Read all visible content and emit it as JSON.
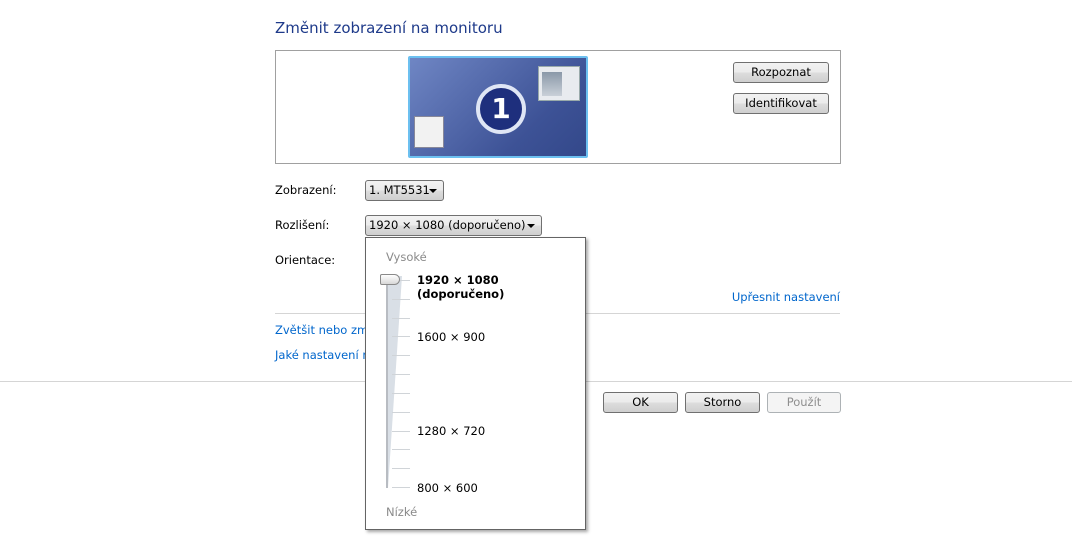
{
  "title": "Změnit zobrazení na monitoru",
  "preview": {
    "monitor_number": "1",
    "detect_button": "Rozpoznat",
    "identify_button": "Identifikovat"
  },
  "display": {
    "label": "Zobrazení:",
    "value": "1. MT5531"
  },
  "resolution": {
    "label": "Rozlišení:",
    "value": "1920 × 1080 (doporučeno)"
  },
  "orientation": {
    "label": "Orientace:"
  },
  "advanced_link": "Upřesnit nastavení",
  "links": [
    "Zvětšit nebo zme",
    "Jaké nastavení m"
  ],
  "buttons": {
    "ok": "OK",
    "cancel": "Storno",
    "apply": "Použít"
  },
  "dropdown": {
    "high_label": "Vysoké",
    "low_label": "Nízké",
    "options": [
      "1920 × 1080 (doporučeno)",
      "1600 × 900",
      "1280 × 720",
      "800 × 600"
    ],
    "selected_index": 0,
    "tick_count": 12
  }
}
